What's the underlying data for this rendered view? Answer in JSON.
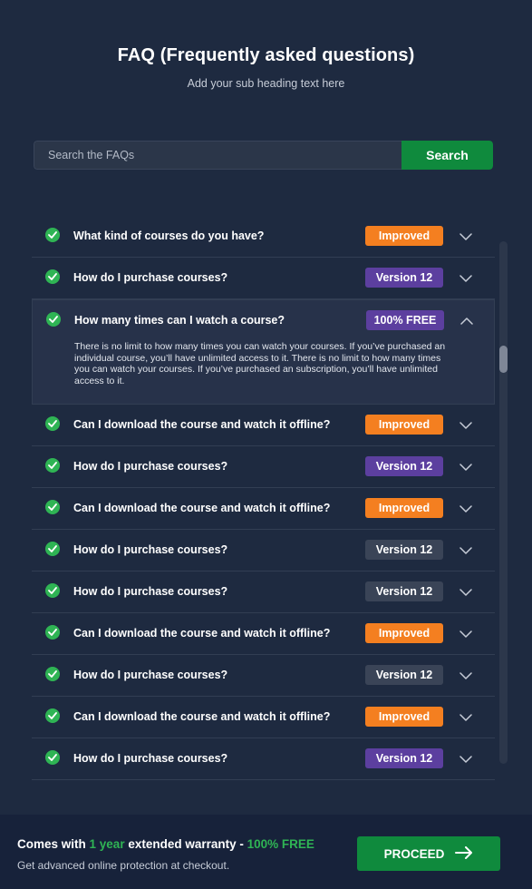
{
  "header": {
    "title": "FAQ (Frequently asked questions)",
    "subtitle": "Add your sub heading text here"
  },
  "search": {
    "placeholder": "Search the FAQs",
    "value": "",
    "button_label": "Search"
  },
  "colors": {
    "background": "#1e2a40",
    "accent_green": "#0f8a3d",
    "check_green": "#2fb454",
    "badge_orange": "#f47f20",
    "badge_purple": "#5c3f9f",
    "badge_gray": "#3a4457"
  },
  "faq": {
    "items": [
      {
        "question": "What kind of courses do you have?",
        "badge": "Improved",
        "badge_color": "#f47f20",
        "expanded": false,
        "answer": "",
        "icon": "check-circle-icon"
      },
      {
        "question": "How do I purchase courses?",
        "badge": "Version 12",
        "badge_color": "#5c3f9f",
        "expanded": false,
        "answer": "",
        "icon": "check-circle-icon"
      },
      {
        "question": "How many times can I watch a course?",
        "badge": "100% FREE",
        "badge_color": "#5c3f9f",
        "expanded": true,
        "answer": "There is no limit to how many times you can watch your courses. If you’ve purchased an individual course, you’ll have unlimited access to it. There is no limit to how many times you can watch your courses. If you’ve purchased an subscription, you’ll have unlimited access to it.",
        "icon": "check-circle-icon"
      },
      {
        "question": "Can I download the course and watch it offline?",
        "badge": "Improved",
        "badge_color": "#f47f20",
        "expanded": false,
        "answer": "",
        "icon": "check-circle-icon"
      },
      {
        "question": "How do I purchase courses?",
        "badge": "Version 12",
        "badge_color": "#5c3f9f",
        "expanded": false,
        "answer": "",
        "icon": "check-circle-icon"
      },
      {
        "question": "Can I download the course and watch it offline?",
        "badge": "Improved",
        "badge_color": "#f47f20",
        "expanded": false,
        "answer": "",
        "icon": "check-circle-icon"
      },
      {
        "question": "How do I purchase courses?",
        "badge": "Version 12",
        "badge_color": "#3a4457",
        "expanded": false,
        "answer": "",
        "icon": "check-circle-icon"
      },
      {
        "question": "How do I purchase courses?",
        "badge": "Version 12",
        "badge_color": "#3a4457",
        "expanded": false,
        "answer": "",
        "icon": "check-circle-icon"
      },
      {
        "question": "Can I download the course and watch it offline?",
        "badge": "Improved",
        "badge_color": "#f47f20",
        "expanded": false,
        "answer": "",
        "icon": "check-circle-icon"
      },
      {
        "question": "How do I purchase courses?",
        "badge": "Version 12",
        "badge_color": "#3a4457",
        "expanded": false,
        "answer": "",
        "icon": "check-circle-icon"
      },
      {
        "question": "Can I download the course and watch it offline?",
        "badge": "Improved",
        "badge_color": "#f47f20",
        "expanded": false,
        "answer": "",
        "icon": "check-circle-icon"
      },
      {
        "question": "How do I purchase courses?",
        "badge": "Version 12",
        "badge_color": "#5c3f9f",
        "expanded": false,
        "answer": "",
        "icon": "check-circle-icon"
      }
    ]
  },
  "footer": {
    "title_prefix": "Comes with",
    "title_highlight": "1 year",
    "title_middle": "extended warranty -",
    "title_highlight2": "100% FREE",
    "subtitle": "Get advanced online protection at checkout.",
    "button_label": "PROCEED",
    "button_icon": "arrow-right-icon"
  }
}
